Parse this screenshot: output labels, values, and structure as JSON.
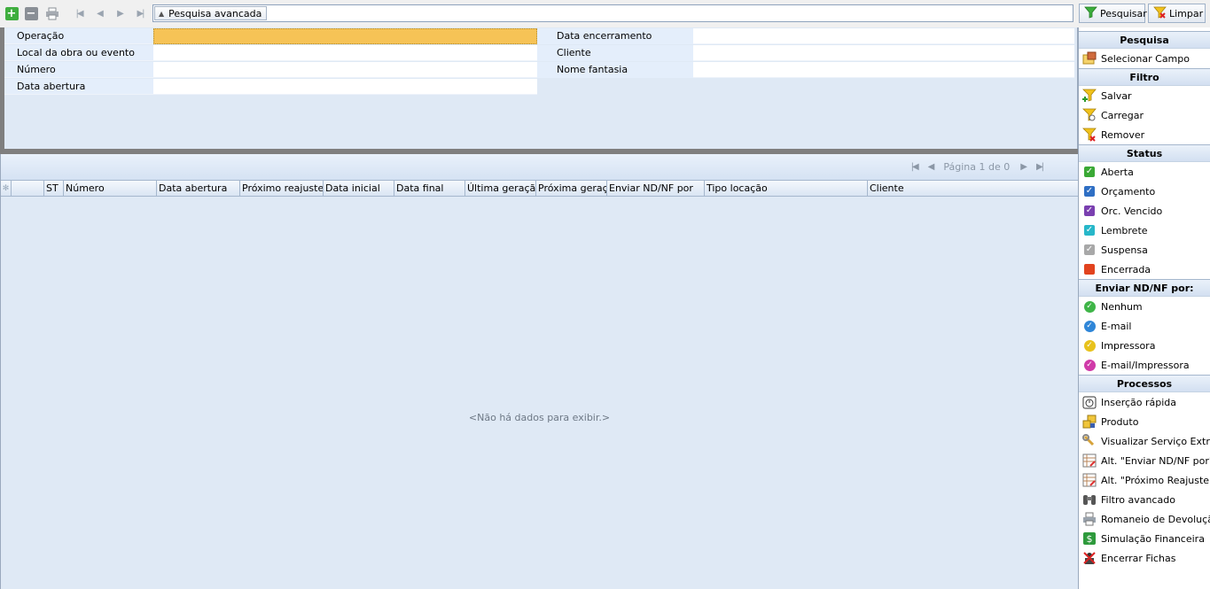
{
  "toolbar": {
    "advanced_search_label": "Pesquisa avancada",
    "search_value": "",
    "pesquisar_label": "Pesquisar",
    "limpar_label": "Limpar"
  },
  "form": {
    "left_fields": [
      {
        "label": "Operação",
        "value": ""
      },
      {
        "label": "Local da obra ou evento",
        "value": ""
      },
      {
        "label": "Número",
        "value": ""
      },
      {
        "label": "Data abertura",
        "value": ""
      }
    ],
    "right_fields": [
      {
        "label": "Data encerramento",
        "value": ""
      },
      {
        "label": "Cliente",
        "value": ""
      },
      {
        "label": "Nome fantasia",
        "value": ""
      }
    ]
  },
  "pager": {
    "text": "Página 1 de 0"
  },
  "grid": {
    "columns": [
      "ST",
      "Número",
      "Data abertura",
      "Próximo reajuste",
      "Data inicial",
      "Data final",
      "Última geração",
      "Próxima geração",
      "Enviar ND/NF por",
      "Tipo locação",
      "Cliente"
    ],
    "empty_message": "<Não há dados para exibir.>"
  },
  "side": {
    "pesquisa": {
      "title": "Pesquisa",
      "items": [
        {
          "label": "Selecionar Campo",
          "icon": "select-field-icon"
        }
      ]
    },
    "filtro": {
      "title": "Filtro",
      "items": [
        {
          "label": "Salvar",
          "icon": "filter-save-icon"
        },
        {
          "label": "Carregar",
          "icon": "filter-load-icon"
        },
        {
          "label": "Remover",
          "icon": "filter-remove-icon"
        }
      ]
    },
    "status": {
      "title": "Status",
      "items": [
        {
          "label": "Aberta",
          "color": "#3aa935"
        },
        {
          "label": "Orçamento",
          "color": "#2f6fc4"
        },
        {
          "label": "Orc. Vencido",
          "color": "#7a3fb0"
        },
        {
          "label": "Lembrete",
          "color": "#27b7c9"
        },
        {
          "label": "Suspensa",
          "color": "#a8a8a8"
        },
        {
          "label": "Encerrada",
          "color": "#e2431e"
        }
      ]
    },
    "enviar": {
      "title": "Enviar ND/NF por:",
      "items": [
        {
          "label": "Nenhum",
          "color": "#3fb548"
        },
        {
          "label": "E-mail",
          "color": "#2f86d8"
        },
        {
          "label": "Impressora",
          "color": "#e8c21c"
        },
        {
          "label": "E-mail/Impressora",
          "color": "#d03aa8"
        }
      ]
    },
    "processos": {
      "title": "Processos",
      "items": [
        {
          "label": "Inserção rápida",
          "icon": "stopwatch-icon"
        },
        {
          "label": "Produto",
          "icon": "boxes-icon"
        },
        {
          "label": "Visualizar Serviço Extra",
          "icon": "wrench-icon"
        },
        {
          "label": "Alt. \"Enviar ND/NF por\"",
          "icon": "edit-table-icon"
        },
        {
          "label": "Alt. \"Próximo Reajuste\"",
          "icon": "edit-table-icon"
        },
        {
          "label": "Filtro avancado",
          "icon": "binoculars-icon"
        },
        {
          "label": "Romaneio de Devolução",
          "icon": "printer-icon"
        },
        {
          "label": "Simulação Financeira",
          "icon": "money-icon"
        },
        {
          "label": "Encerrar Fichas",
          "icon": "close-records-icon"
        }
      ]
    }
  }
}
